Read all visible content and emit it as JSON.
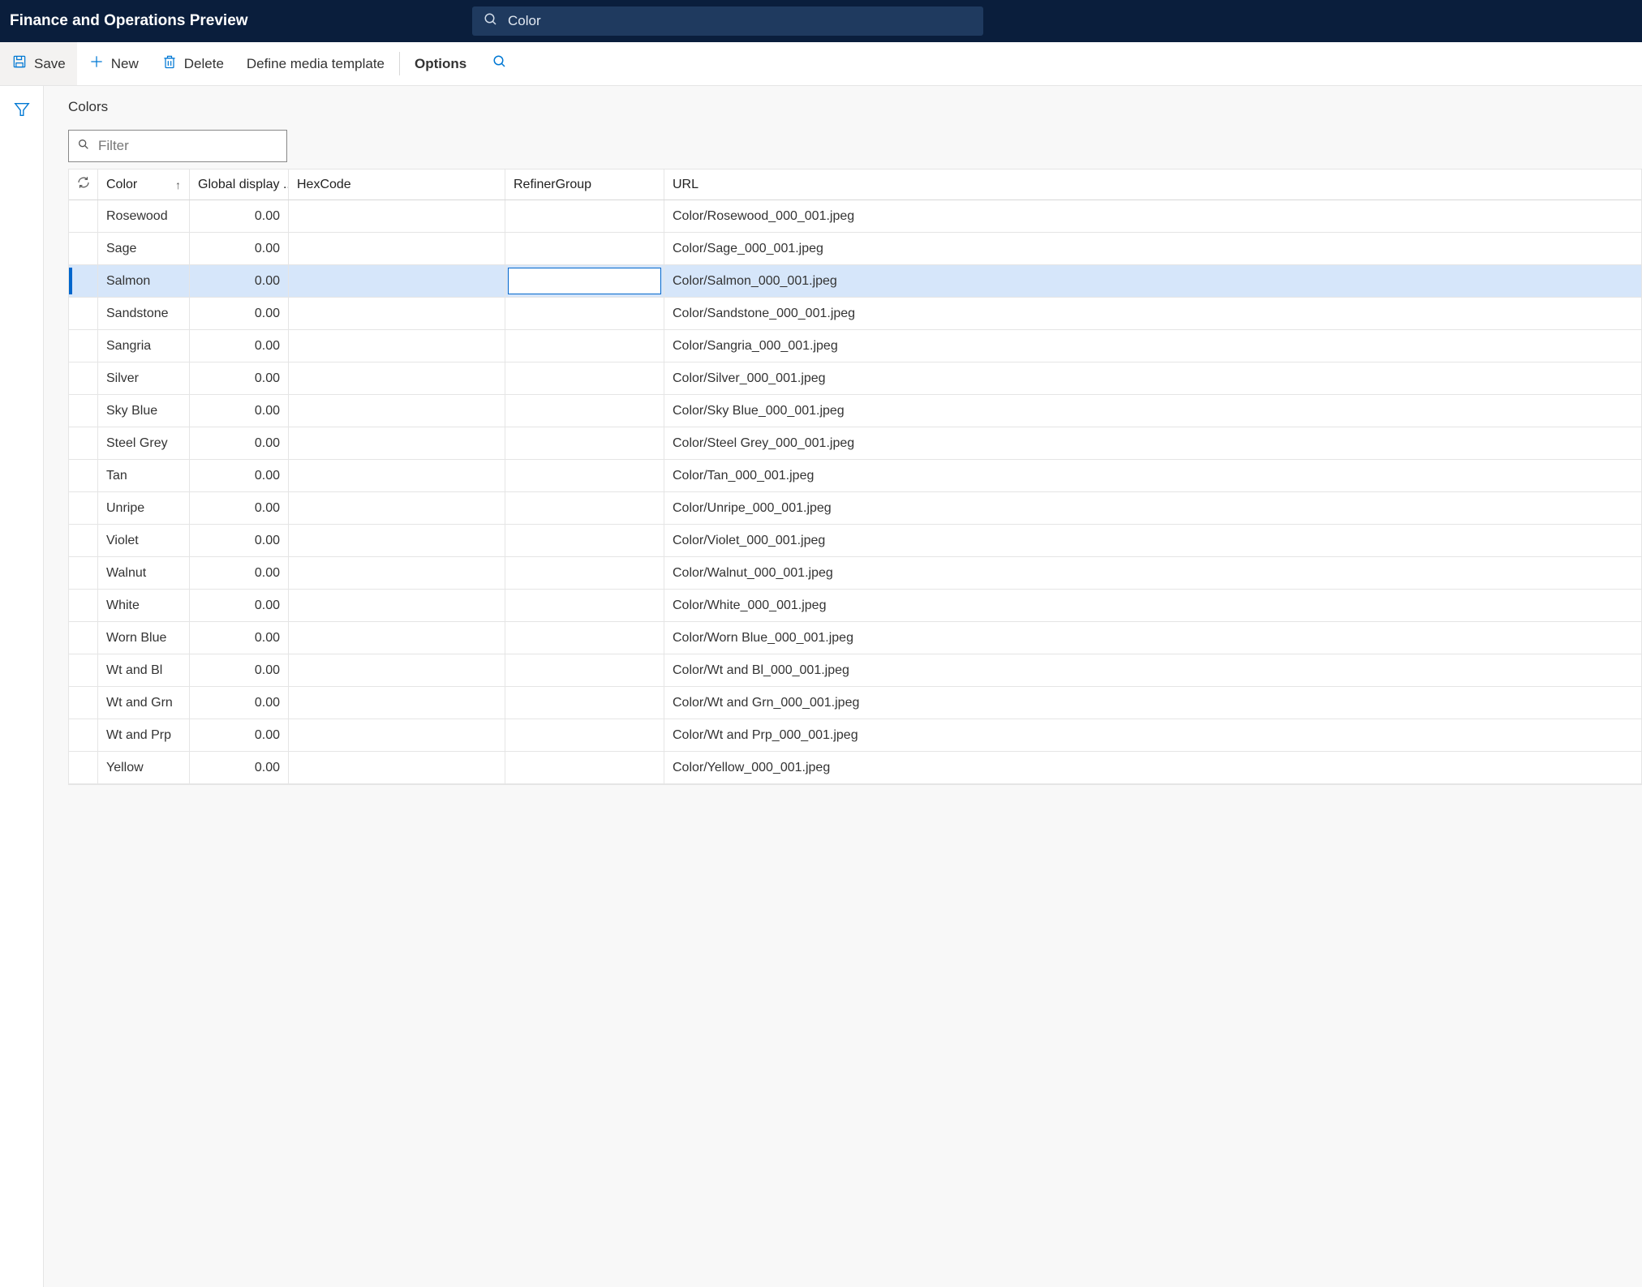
{
  "header": {
    "app_title": "Finance and Operations Preview",
    "search_text": "Color"
  },
  "actions": {
    "save": "Save",
    "new": "New",
    "delete": "Delete",
    "define_media_template": "Define media template",
    "options": "Options"
  },
  "page": {
    "title": "Colors",
    "filter_placeholder": "Filter"
  },
  "grid": {
    "columns": {
      "color": "Color",
      "global_display": "Global display ...",
      "hexcode": "HexCode",
      "refiner_group": "RefinerGroup",
      "url": "URL"
    },
    "selected_index": 2,
    "rows": [
      {
        "color": "Rosewood",
        "gdo": "0.00",
        "hex": "",
        "refiner": "",
        "url": "Color/Rosewood_000_001.jpeg"
      },
      {
        "color": "Sage",
        "gdo": "0.00",
        "hex": "",
        "refiner": "",
        "url": "Color/Sage_000_001.jpeg"
      },
      {
        "color": "Salmon",
        "gdo": "0.00",
        "hex": "",
        "refiner": "",
        "url": "Color/Salmon_000_001.jpeg"
      },
      {
        "color": "Sandstone",
        "gdo": "0.00",
        "hex": "",
        "refiner": "",
        "url": "Color/Sandstone_000_001.jpeg"
      },
      {
        "color": "Sangria",
        "gdo": "0.00",
        "hex": "",
        "refiner": "",
        "url": "Color/Sangria_000_001.jpeg"
      },
      {
        "color": "Silver",
        "gdo": "0.00",
        "hex": "",
        "refiner": "",
        "url": "Color/Silver_000_001.jpeg"
      },
      {
        "color": "Sky Blue",
        "gdo": "0.00",
        "hex": "",
        "refiner": "",
        "url": "Color/Sky Blue_000_001.jpeg"
      },
      {
        "color": "Steel Grey",
        "gdo": "0.00",
        "hex": "",
        "refiner": "",
        "url": "Color/Steel Grey_000_001.jpeg"
      },
      {
        "color": "Tan",
        "gdo": "0.00",
        "hex": "",
        "refiner": "",
        "url": "Color/Tan_000_001.jpeg"
      },
      {
        "color": "Unripe",
        "gdo": "0.00",
        "hex": "",
        "refiner": "",
        "url": "Color/Unripe_000_001.jpeg"
      },
      {
        "color": "Violet",
        "gdo": "0.00",
        "hex": "",
        "refiner": "",
        "url": "Color/Violet_000_001.jpeg"
      },
      {
        "color": "Walnut",
        "gdo": "0.00",
        "hex": "",
        "refiner": "",
        "url": "Color/Walnut_000_001.jpeg"
      },
      {
        "color": "White",
        "gdo": "0.00",
        "hex": "",
        "refiner": "",
        "url": "Color/White_000_001.jpeg"
      },
      {
        "color": "Worn Blue",
        "gdo": "0.00",
        "hex": "",
        "refiner": "",
        "url": "Color/Worn Blue_000_001.jpeg"
      },
      {
        "color": "Wt and Bl",
        "gdo": "0.00",
        "hex": "",
        "refiner": "",
        "url": "Color/Wt and Bl_000_001.jpeg"
      },
      {
        "color": "Wt and Grn",
        "gdo": "0.00",
        "hex": "",
        "refiner": "",
        "url": "Color/Wt and Grn_000_001.jpeg"
      },
      {
        "color": "Wt and Prp",
        "gdo": "0.00",
        "hex": "",
        "refiner": "",
        "url": "Color/Wt and Prp_000_001.jpeg"
      },
      {
        "color": "Yellow",
        "gdo": "0.00",
        "hex": "",
        "refiner": "",
        "url": "Color/Yellow_000_001.jpeg"
      }
    ]
  }
}
